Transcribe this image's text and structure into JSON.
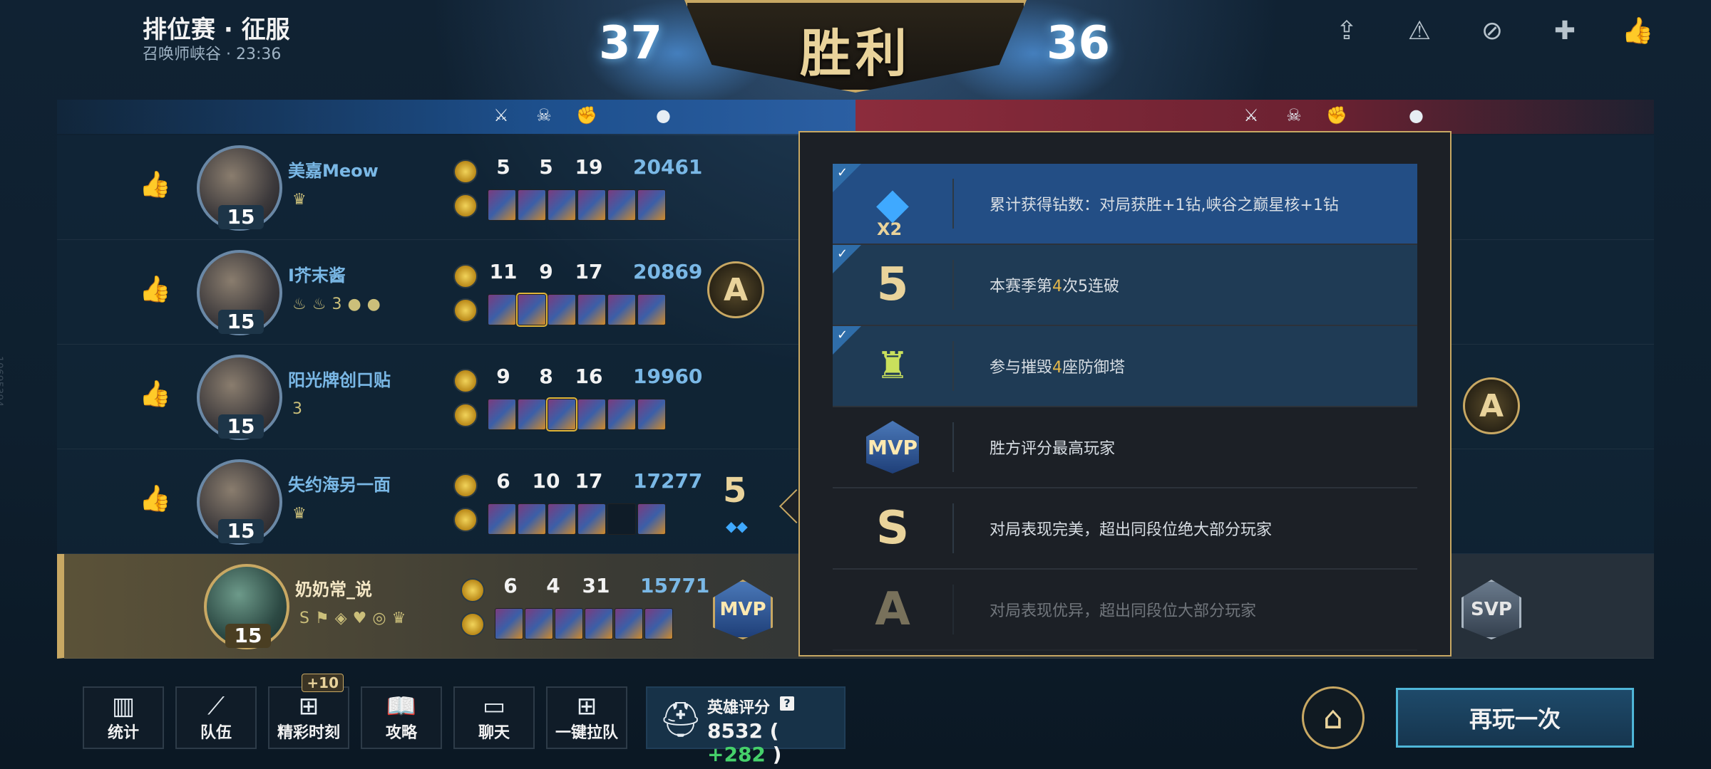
{
  "header": {
    "mode_title": "排位赛 · 征服",
    "subtitle": "召唤师峡谷 · 23:36",
    "score_blue": "37",
    "score_red": "36",
    "result": "胜利"
  },
  "top_icons": [
    "share-icon",
    "report-icon",
    "block-user-icon",
    "add-friend-icon",
    "like-icon"
  ],
  "players": [
    {
      "name": "美嘉Meow",
      "level": "15",
      "k": "5",
      "d": "5",
      "a": "19",
      "gold": "20461",
      "badges": [
        "♛"
      ],
      "medal": ""
    },
    {
      "name": "I芥末酱",
      "level": "15",
      "k": "11",
      "d": "9",
      "a": "17",
      "gold": "20869",
      "badges": [
        "♨",
        "♨",
        "3",
        "●",
        "●"
      ],
      "medal": "A"
    },
    {
      "name": "阳光牌创口贴",
      "level": "15",
      "k": "9",
      "d": "8",
      "a": "16",
      "gold": "19960",
      "badges": [
        "3"
      ],
      "medal": ""
    },
    {
      "name": "失约海另一面",
      "level": "15",
      "k": "6",
      "d": "10",
      "a": "17",
      "gold": "17277",
      "badges": [
        "♛"
      ],
      "medal": "5"
    },
    {
      "name": "奶奶常_说",
      "level": "15",
      "k": "6",
      "d": "4",
      "a": "31",
      "gold": "15771",
      "badges": [
        "S",
        "⚑",
        "◈",
        "♥",
        "◎",
        "♛"
      ],
      "medal": "MVP"
    }
  ],
  "right_team": {
    "medal_a": "A",
    "medal_svp": "SVP"
  },
  "popup": {
    "items": [
      {
        "icon": "diamond-icon",
        "multiplier": "X2",
        "text": "累计获得钻数：对局获胜+1钻,峡谷之巅星核+1钻",
        "checked": true
      },
      {
        "icon": "five-streak-icon",
        "glyph": "5",
        "text_pre": "本赛季第",
        "text_hl": "4",
        "text_post": "次5连破",
        "checked": true
      },
      {
        "icon": "tower-icon",
        "text_pre": "参与摧毁",
        "text_hl": "4",
        "text_post": "座防御塔",
        "checked": true
      },
      {
        "icon": "mvp-icon",
        "glyph": "MVP",
        "text": "胜方评分最高玩家",
        "checked": false
      },
      {
        "icon": "s-rank-icon",
        "glyph": "S",
        "text": "对局表现完美，超出同段位绝大部分玩家",
        "checked": false
      },
      {
        "icon": "a-rank-icon",
        "glyph": "A",
        "text": "对局表现优异，超出同段位大部分玩家",
        "checked": false
      }
    ]
  },
  "bottom": {
    "buttons": [
      {
        "label": "统计",
        "icon": "stats-icon"
      },
      {
        "label": "队伍",
        "icon": "team-icon"
      },
      {
        "label": "精彩时刻",
        "icon": "highlight-icon",
        "badge": "+10"
      },
      {
        "label": "攻略",
        "icon": "guide-icon"
      },
      {
        "label": "聊天",
        "icon": "chat-icon"
      },
      {
        "label": "一键拉队",
        "icon": "invite-team-icon"
      }
    ],
    "hero_score_label": "英雄评分",
    "hero_score_value": "8532",
    "hero_score_delta": "+282",
    "replay_label": "再玩一次"
  },
  "side_text": "10695394"
}
